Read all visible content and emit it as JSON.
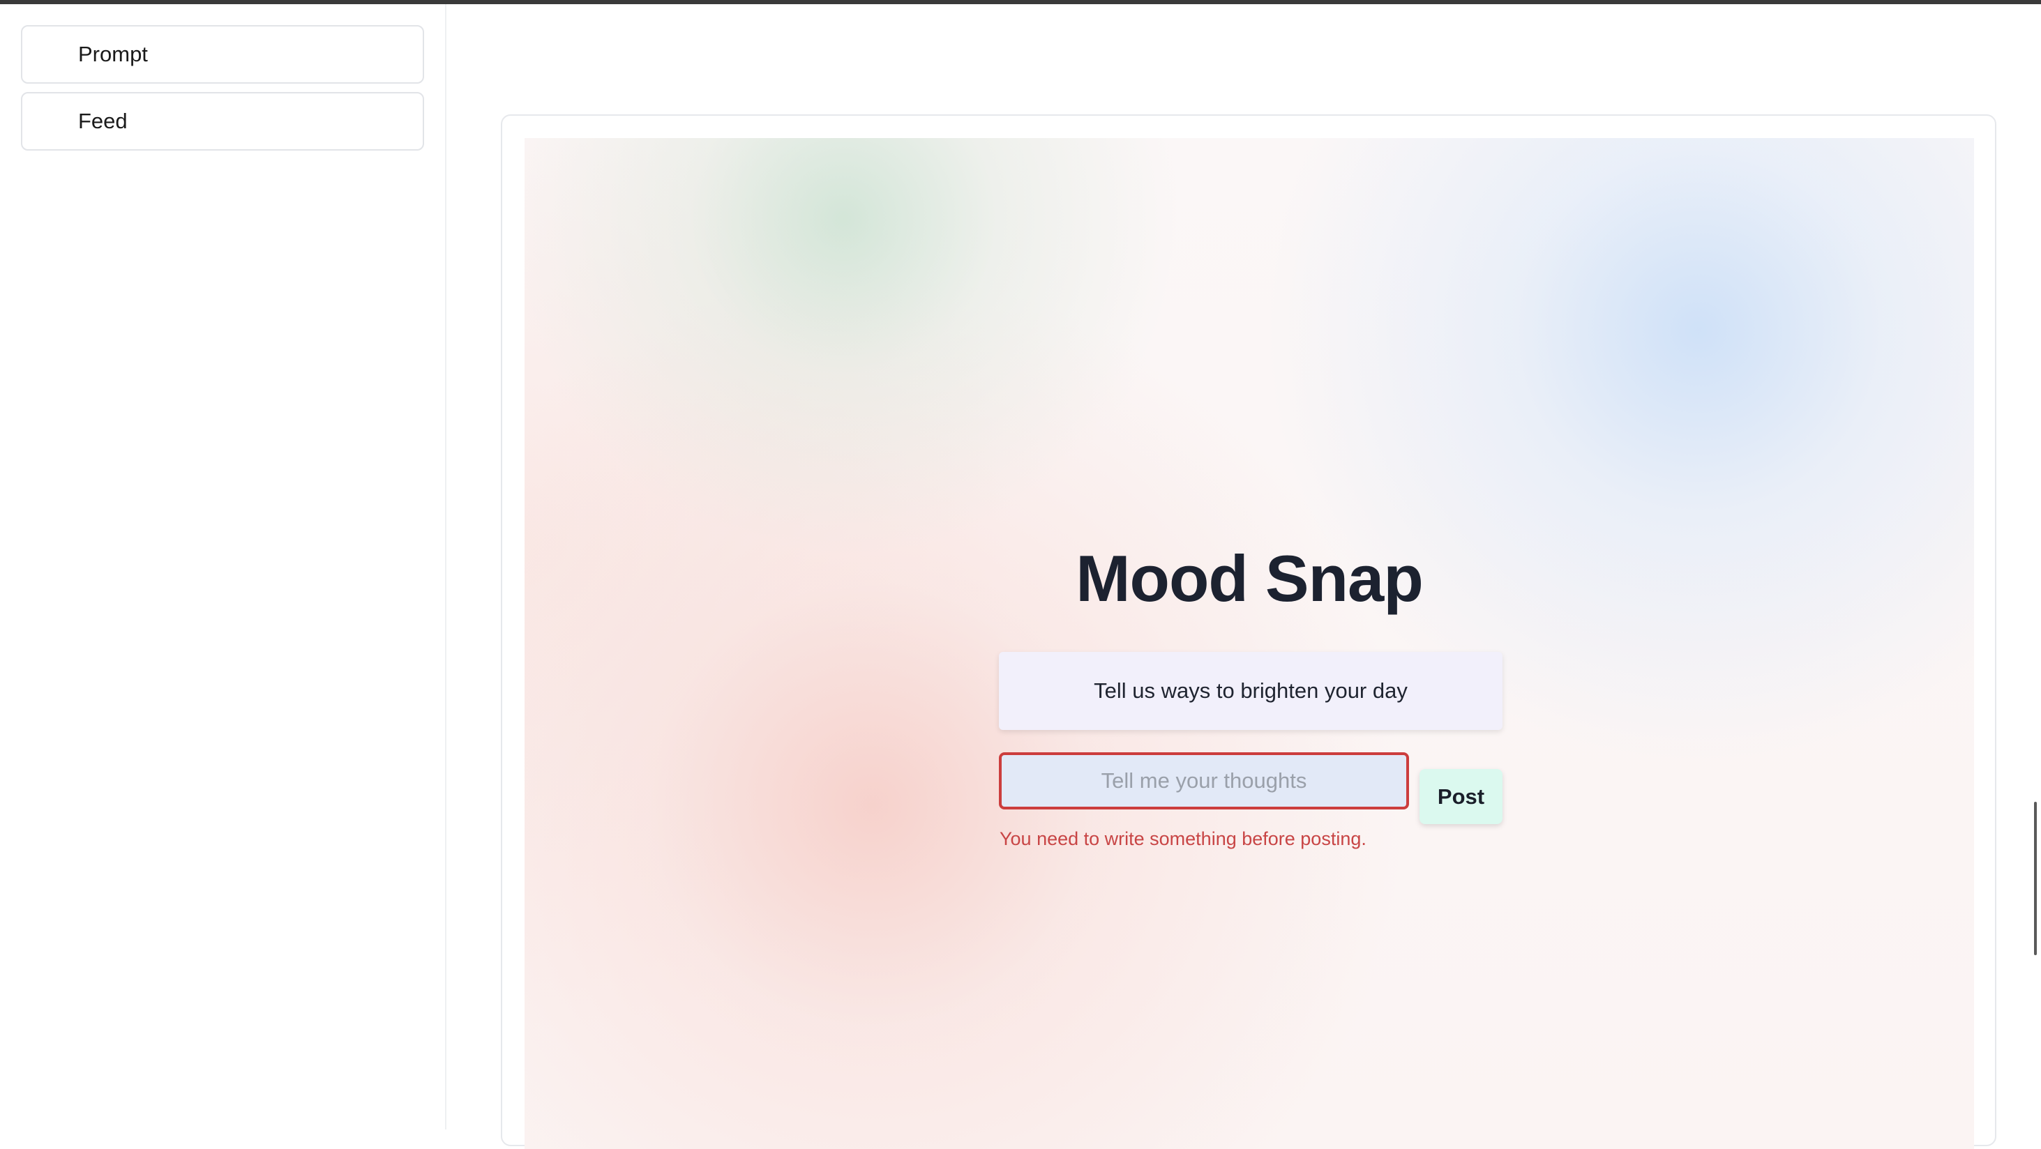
{
  "sidebar": {
    "items": [
      {
        "label": "Prompt"
      },
      {
        "label": "Feed"
      }
    ]
  },
  "main": {
    "title": "Mood Snap",
    "prompt_text": "Tell us ways to brighten your day",
    "input": {
      "value": "",
      "placeholder": "Tell me your thoughts"
    },
    "post_label": "Post",
    "error_message": "You need to write something before posting."
  },
  "colors": {
    "error": "#cc3d3d",
    "post_button_bg": "#dbf9ef",
    "input_bg": "#e2e9f7",
    "prompt_bg": "#f2f0fb",
    "title": "#1c2230"
  }
}
